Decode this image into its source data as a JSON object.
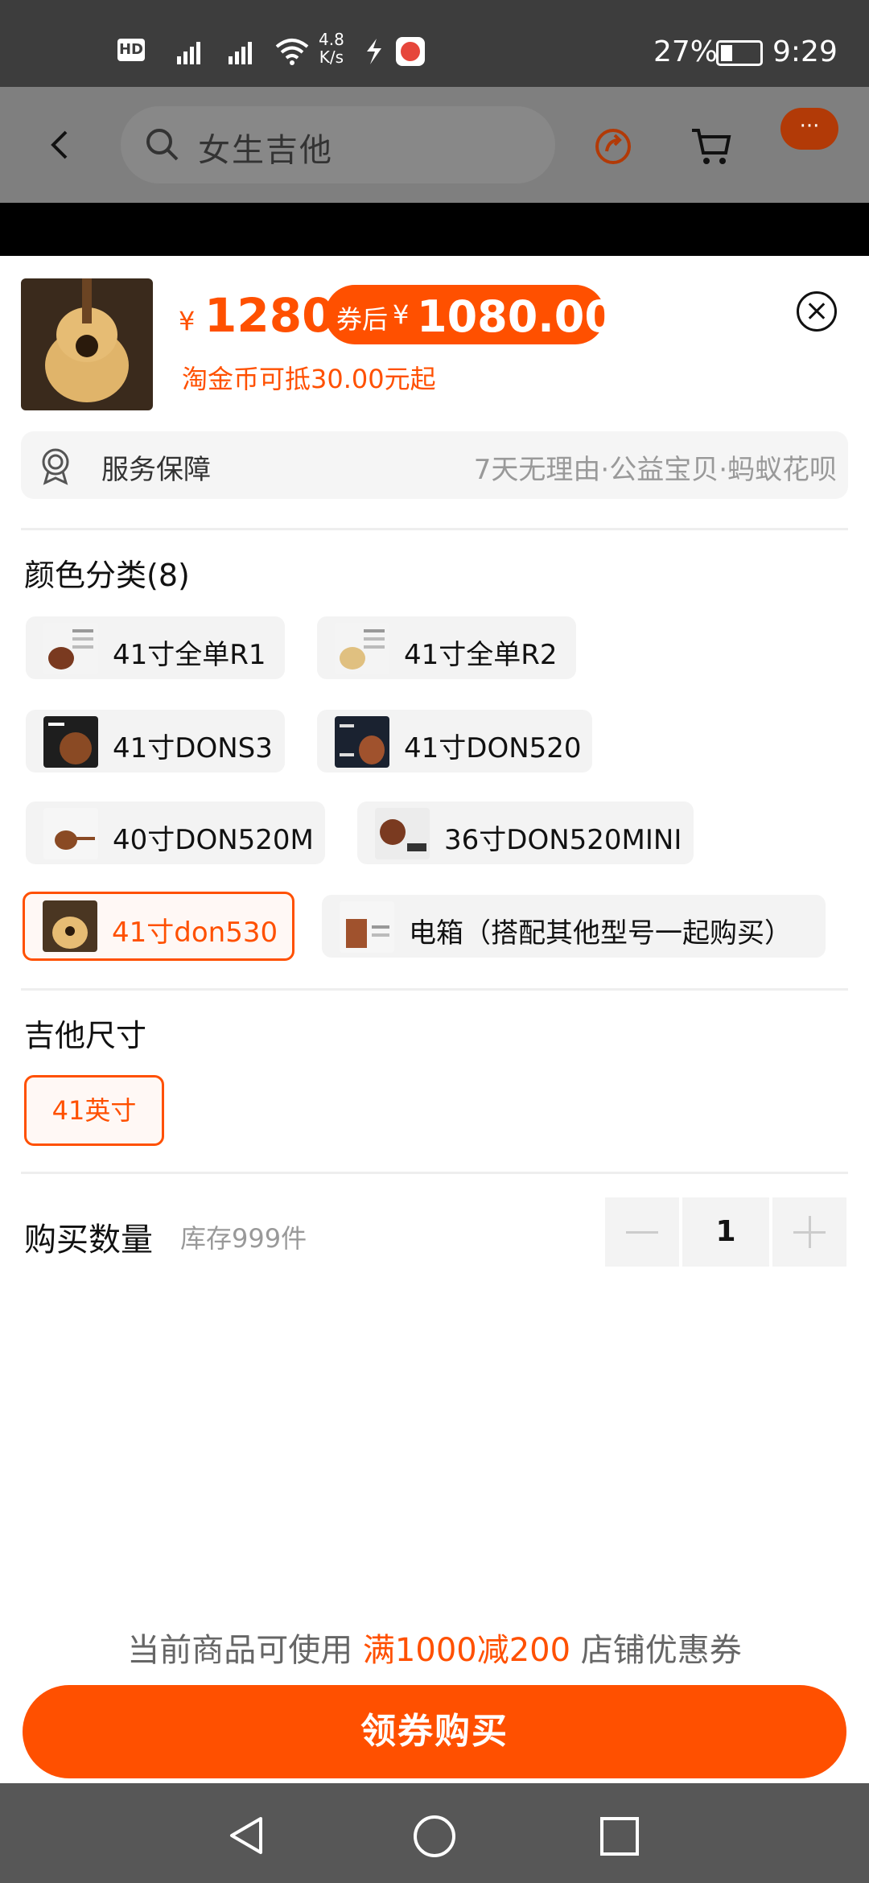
{
  "status_bar": {
    "hd_label": "HD",
    "net_speed_value": "4.8",
    "net_speed_unit": "K/s",
    "battery_percent": "27%",
    "time": "9:29"
  },
  "header": {
    "search_placeholder": "女生吉他",
    "more_label": "···"
  },
  "product": {
    "price_symbol": "¥",
    "price": "1280",
    "coupon_label": "券后",
    "coupon_symbol": "¥",
    "coupon_price": "1080.00",
    "coin_text": "淘金币可抵30.00元起"
  },
  "service": {
    "label": "服务保障",
    "detail": "7天无理由·公益宝贝·蚂蚁花呗"
  },
  "color_section": {
    "title": "颜色分类(8)",
    "options": [
      {
        "label": "41寸全单R1"
      },
      {
        "label": "41寸全单R2"
      },
      {
        "label": "41寸DONS3"
      },
      {
        "label": "41寸DON520"
      },
      {
        "label": "40寸DON520M"
      },
      {
        "label": "36寸DON520MINI"
      },
      {
        "label": "41寸don530",
        "selected": true
      },
      {
        "label": "电箱（搭配其他型号一起购买）"
      }
    ]
  },
  "size_section": {
    "title": "吉他尺寸",
    "options": [
      {
        "label": "41英寸",
        "selected": true
      }
    ]
  },
  "quantity": {
    "label": "购买数量",
    "stock": "库存999件",
    "value": "1"
  },
  "promo": {
    "prefix": "当前商品可使用",
    "highlight": "满1000减200",
    "suffix": "店铺优惠券"
  },
  "buy_button": "领券购买",
  "colors": {
    "accent": "#ff5000",
    "status_bar": "#3d3d3d",
    "overlay": "#7f7f7f",
    "nav_bar": "#575757"
  }
}
